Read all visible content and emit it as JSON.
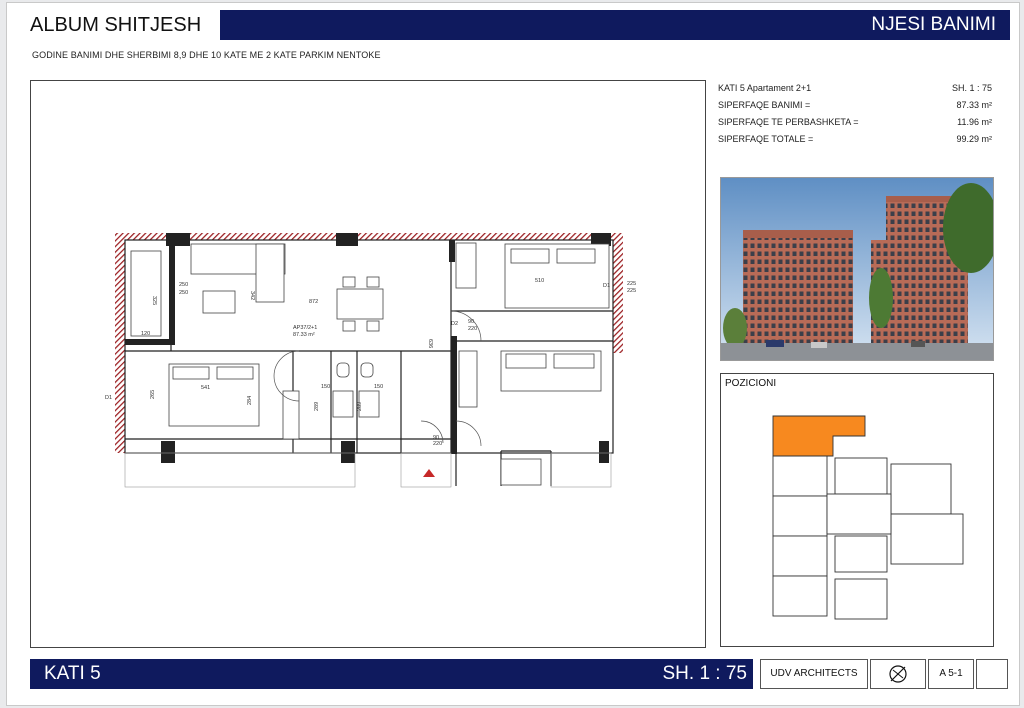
{
  "header": {
    "album_title": "ALBUM SHITJESH",
    "section_title": "NJESI BANIMI",
    "subtitle": "GODINE BANIMI DHE SHERBIMI 8,9 DHE 10 KATE ME 2 KATE PARKIM NENTOKE"
  },
  "info": {
    "floor_apartment": "KATI 5 Apartament 2+1",
    "scale": "SH. 1 : 75",
    "rows": [
      {
        "label": "SIPERFAQE BANIMI =",
        "value": "87.33 m²"
      },
      {
        "label": "SIPERFAQE TE PERBASHKETA =",
        "value": "11.96 m²"
      },
      {
        "label": "SIPERFAQE TOTALE =",
        "value": "99.29 m²"
      }
    ]
  },
  "plan": {
    "unit_label": "AP37/2+1",
    "unit_area": "87.33 m²",
    "dims": [
      "250",
      "250",
      "325",
      "872",
      "342",
      "120",
      "541",
      "265",
      "284",
      "150",
      "150",
      "289",
      "289",
      "636",
      "90",
      "220",
      "510",
      "225",
      "225",
      "D1",
      "D1",
      "D2",
      "90",
      "220"
    ]
  },
  "position": {
    "label": "POZICIONI",
    "highlight_color": "#f7891f"
  },
  "footer": {
    "floor": "KATI 5",
    "scale": "SH. 1 : 75",
    "architect": "UDV ARCHITECTS",
    "sheet_number": "A 5-1",
    "logo_name": "udv-logo-icon"
  },
  "colors": {
    "bar": "#0f1a5e",
    "wall_hatch": "#9b1d20",
    "highlight": "#f7891f"
  }
}
